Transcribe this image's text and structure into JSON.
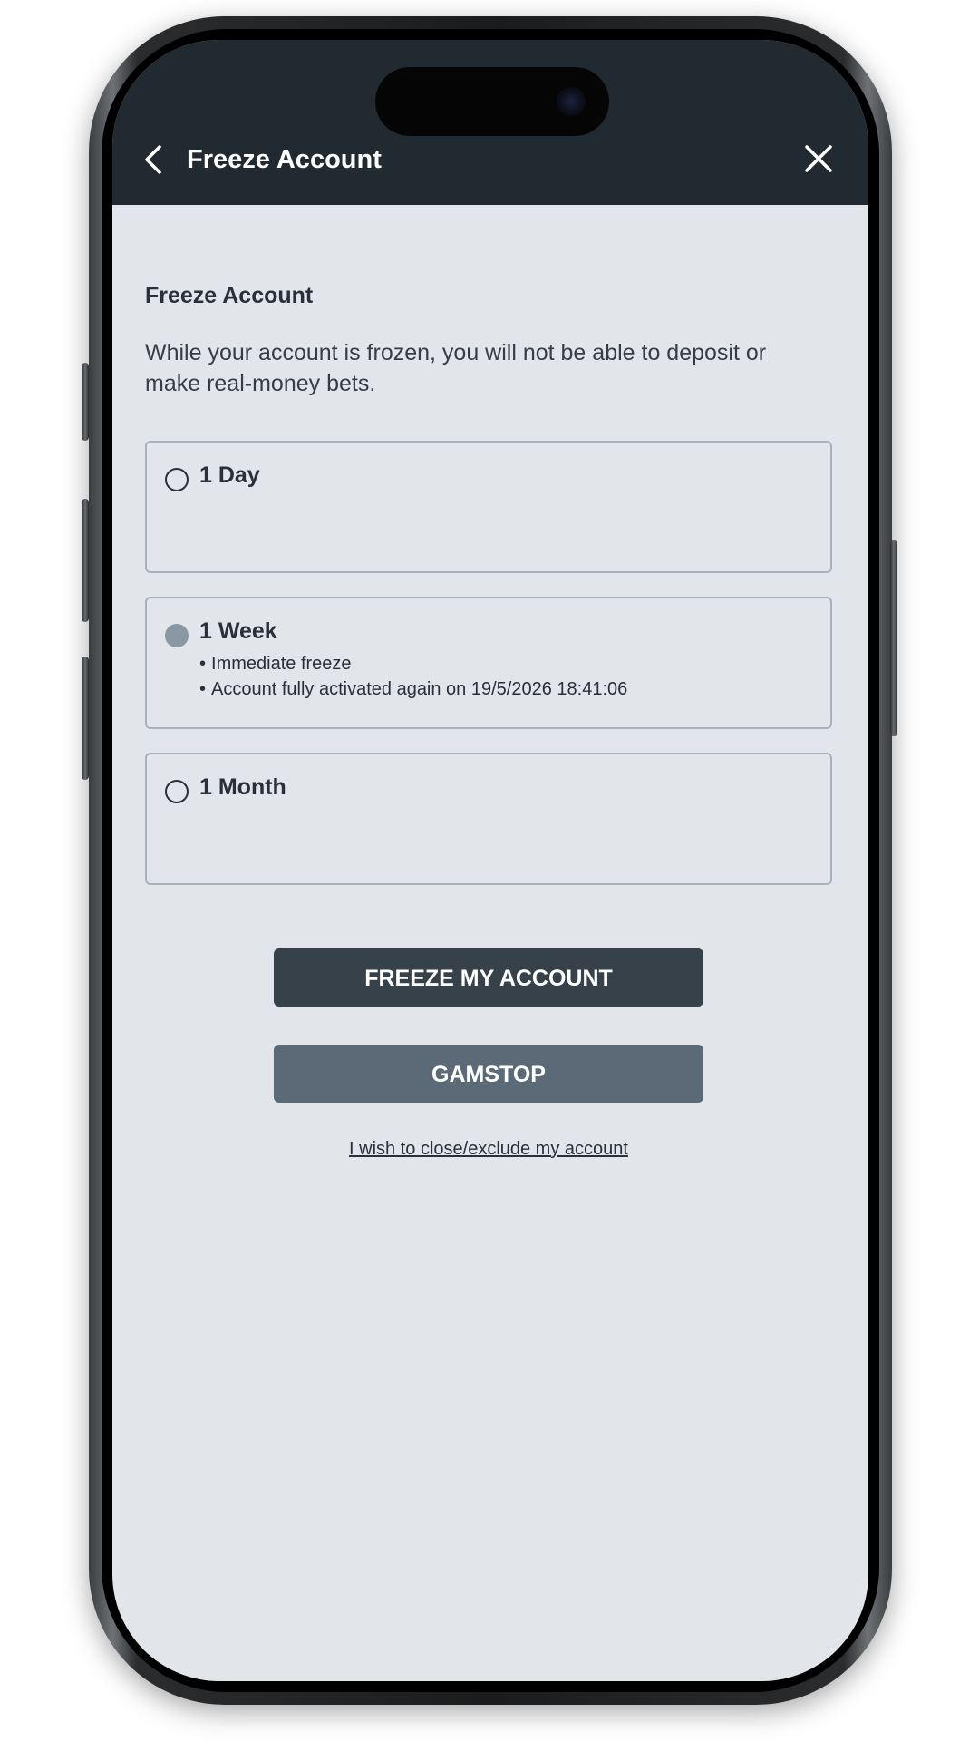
{
  "header": {
    "title": "Freeze Account",
    "back_icon": "chevron-left-icon",
    "close_icon": "close-icon"
  },
  "section": {
    "title": "Freeze Account",
    "description": "While your account is frozen, you will not be able to deposit or make real-money bets."
  },
  "options": [
    {
      "label": "1 Day",
      "selected": false,
      "details": []
    },
    {
      "label": "1 Week",
      "selected": true,
      "details": [
        "Immediate freeze",
        "Account fully activated again on 19/5/2026 18:41:06"
      ]
    },
    {
      "label": "1 Month",
      "selected": false,
      "details": []
    }
  ],
  "buttons": {
    "freeze_label": "FREEZE MY ACCOUNT",
    "gamstop_label": "GAMSTOP"
  },
  "close_link": "I wish to close/exclude my account",
  "colors": {
    "header_bg": "#222a31",
    "screen_bg": "#e2e5e9",
    "primary_button": "#36414a",
    "secondary_button": "#5b6a76",
    "selected_radio": "#8a98a4"
  }
}
